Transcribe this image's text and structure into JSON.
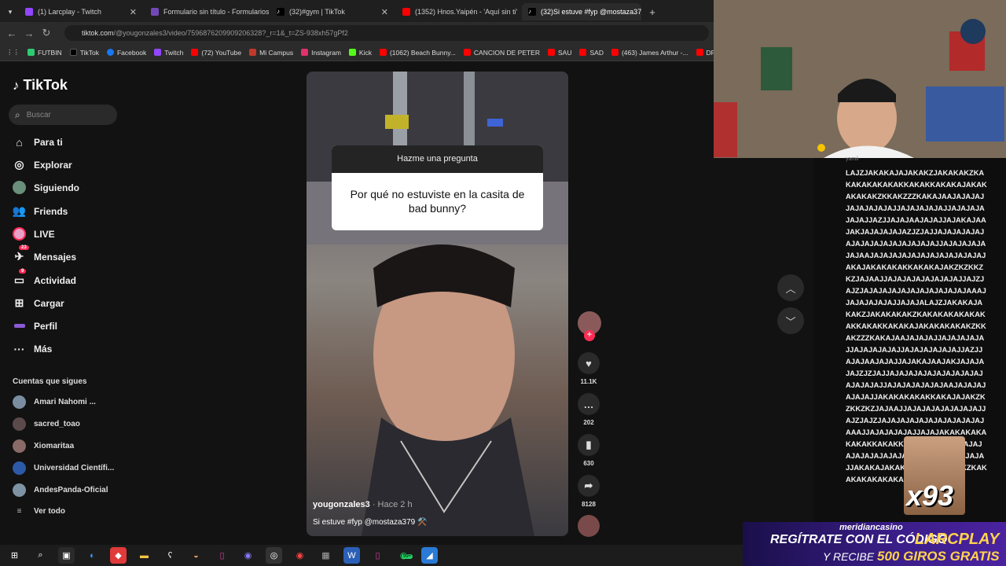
{
  "browser": {
    "tabs": [
      {
        "label": "(1) Larcplay - Twitch",
        "color": "#9146ff"
      },
      {
        "label": "Formulario sin título - Formularios",
        "color": "#7248b9"
      },
      {
        "label": "(32)#gym | TikTok",
        "color": "#ffffff"
      },
      {
        "label": "(1352) Hnos.Yaipén - 'Aquí sin ti'",
        "color": "#ff0000"
      },
      {
        "label": "(32)Si estuve #fyp @mostaza379",
        "color": "#ffffff"
      }
    ],
    "url_domain": "tiktok.com",
    "url_path": "/@yougonzales3/video/7596876209909206328?_r=1&_t=ZS-938xh57gPf2",
    "bookmarks": [
      "FUTBIN",
      "TikTok",
      "Facebook",
      "Twitch",
      "(72) YouTube",
      "Mi Campus",
      "Instagram",
      "Kick",
      "(1062) Beach Bunny...",
      "CANCION DE PETER",
      "SAU",
      "SAD",
      "(463) James Arthur -...",
      "DRAGO"
    ]
  },
  "tiktok": {
    "logo": "TikTok",
    "search_placeholder": "Buscar",
    "nav": [
      {
        "label": "Para ti",
        "icon": "home-icon"
      },
      {
        "label": "Explorar",
        "icon": "compass-icon"
      },
      {
        "label": "Siguiendo",
        "icon": "following-avatar"
      },
      {
        "label": "Friends",
        "icon": "friends-icon"
      },
      {
        "label": "LIVE",
        "icon": "live-icon"
      },
      {
        "label": "Mensajes",
        "icon": "messages-icon",
        "badge": "23"
      },
      {
        "label": "Actividad",
        "icon": "activity-icon",
        "badge": "9"
      },
      {
        "label": "Cargar",
        "icon": "upload-icon"
      },
      {
        "label": "Perfil",
        "icon": "profile-icon"
      },
      {
        "label": "Más",
        "icon": "more-icon"
      }
    ],
    "following_header": "Cuentas que sigues",
    "following": [
      "Amari Nahomi ...",
      "sacred_toao",
      "Xiomaritaa",
      "Universidad Científi...",
      "AndesPanda-Oficial"
    ],
    "see_all": "Ver todo",
    "video": {
      "question_title": "Hazme una pregunta",
      "question_text": "Por qué no estuviste en la casita de bad bunny?",
      "author": "yougonzales3",
      "time": "· Hace 2 h",
      "caption": "Si estuve #fyp @mostaza379 ⚒️"
    },
    "actions": {
      "likes": "11.1K",
      "comments": "202",
      "saves": "630",
      "shares": "8128"
    }
  },
  "chat": {
    "user": "yamii",
    "message": "LAJZJAKAKAJAJAKAKZJAKAKAKZKAKAKAKAKAKAKKAKAKKAKAKAJAKAKAKAKAKZKKAKZZZKAKAJAAJAJAJAJJAJAJAJAJAJJAJAJAJAJAJJAJAJAJAJAJAJJAZJJAJAJAAJAJAJJAJAKAJAAJAKJAJAJAJAJAZJZJAJJAJAJAJAJAJAJAJAJAJAJAJAJAJAJAJJAJAJAJAJAJAJAAJAJAJAJAJAJAJAJAJAJAJAJAJAKAJAKAKAKAKKAKAKAJAKZKZKKZKZJAJAAJJAJAJAJAJAJAJAJAJJAJZJAJZJAJAJAJAJAJAJAJAJAJAJAJAAAJJAJAJAJAJAJJAJAJALAJZJAKAKAJAKAKZJAKAKAKAKZKAKAKAKAKAKAKAKKAKAKKAKAKAJAKAKAKAKAKZKKAKZZZKAKAJAAJAJAJAJJAJAJAJAJAJJAJAJAJAJAJJAJAJAJAJAJAJJAZJJAJAJAAJAJAJJAJAKAJAAJAKJAJAJAJAJZJZJAJJAJAJAJAJAJAJAJAJAJAJAJAJAJAJJAJAJAJAJAJAJAAJAJAJAJAJAJAJJAKAKAKAKAKKAKAJAJAKZKZKKZKZJAJAAJJAJAJAJAJAJAJAJAJJAJZJAJZJAJAJAJAJAJAJAJAJAJAJAJAAAJJAJAJAJAJAJJAJAJAKAKAKAKAKAKAKKAKAKKAKAKAKAJAJAJAJAJAJAJAJAJAJAJAJAJAJJAJZJAJZJAJAJJAKAKAJAKAKAKZJAKAKAKAKZKAKAKAKAKAKAKAKAKAKAKAJAK"
  },
  "overlay": {
    "meme_count": "x93",
    "ad_brand": "meridiancasino",
    "ad_line1": "REGÍTRATE CON EL CÓDIGO",
    "ad_code": "LARCPLAY",
    "ad_line2_prefix": "Y RECIBE",
    "ad_line2_highlight": "500 GIROS GRATIS"
  },
  "taskbar": {
    "chat_badge": "99+"
  }
}
